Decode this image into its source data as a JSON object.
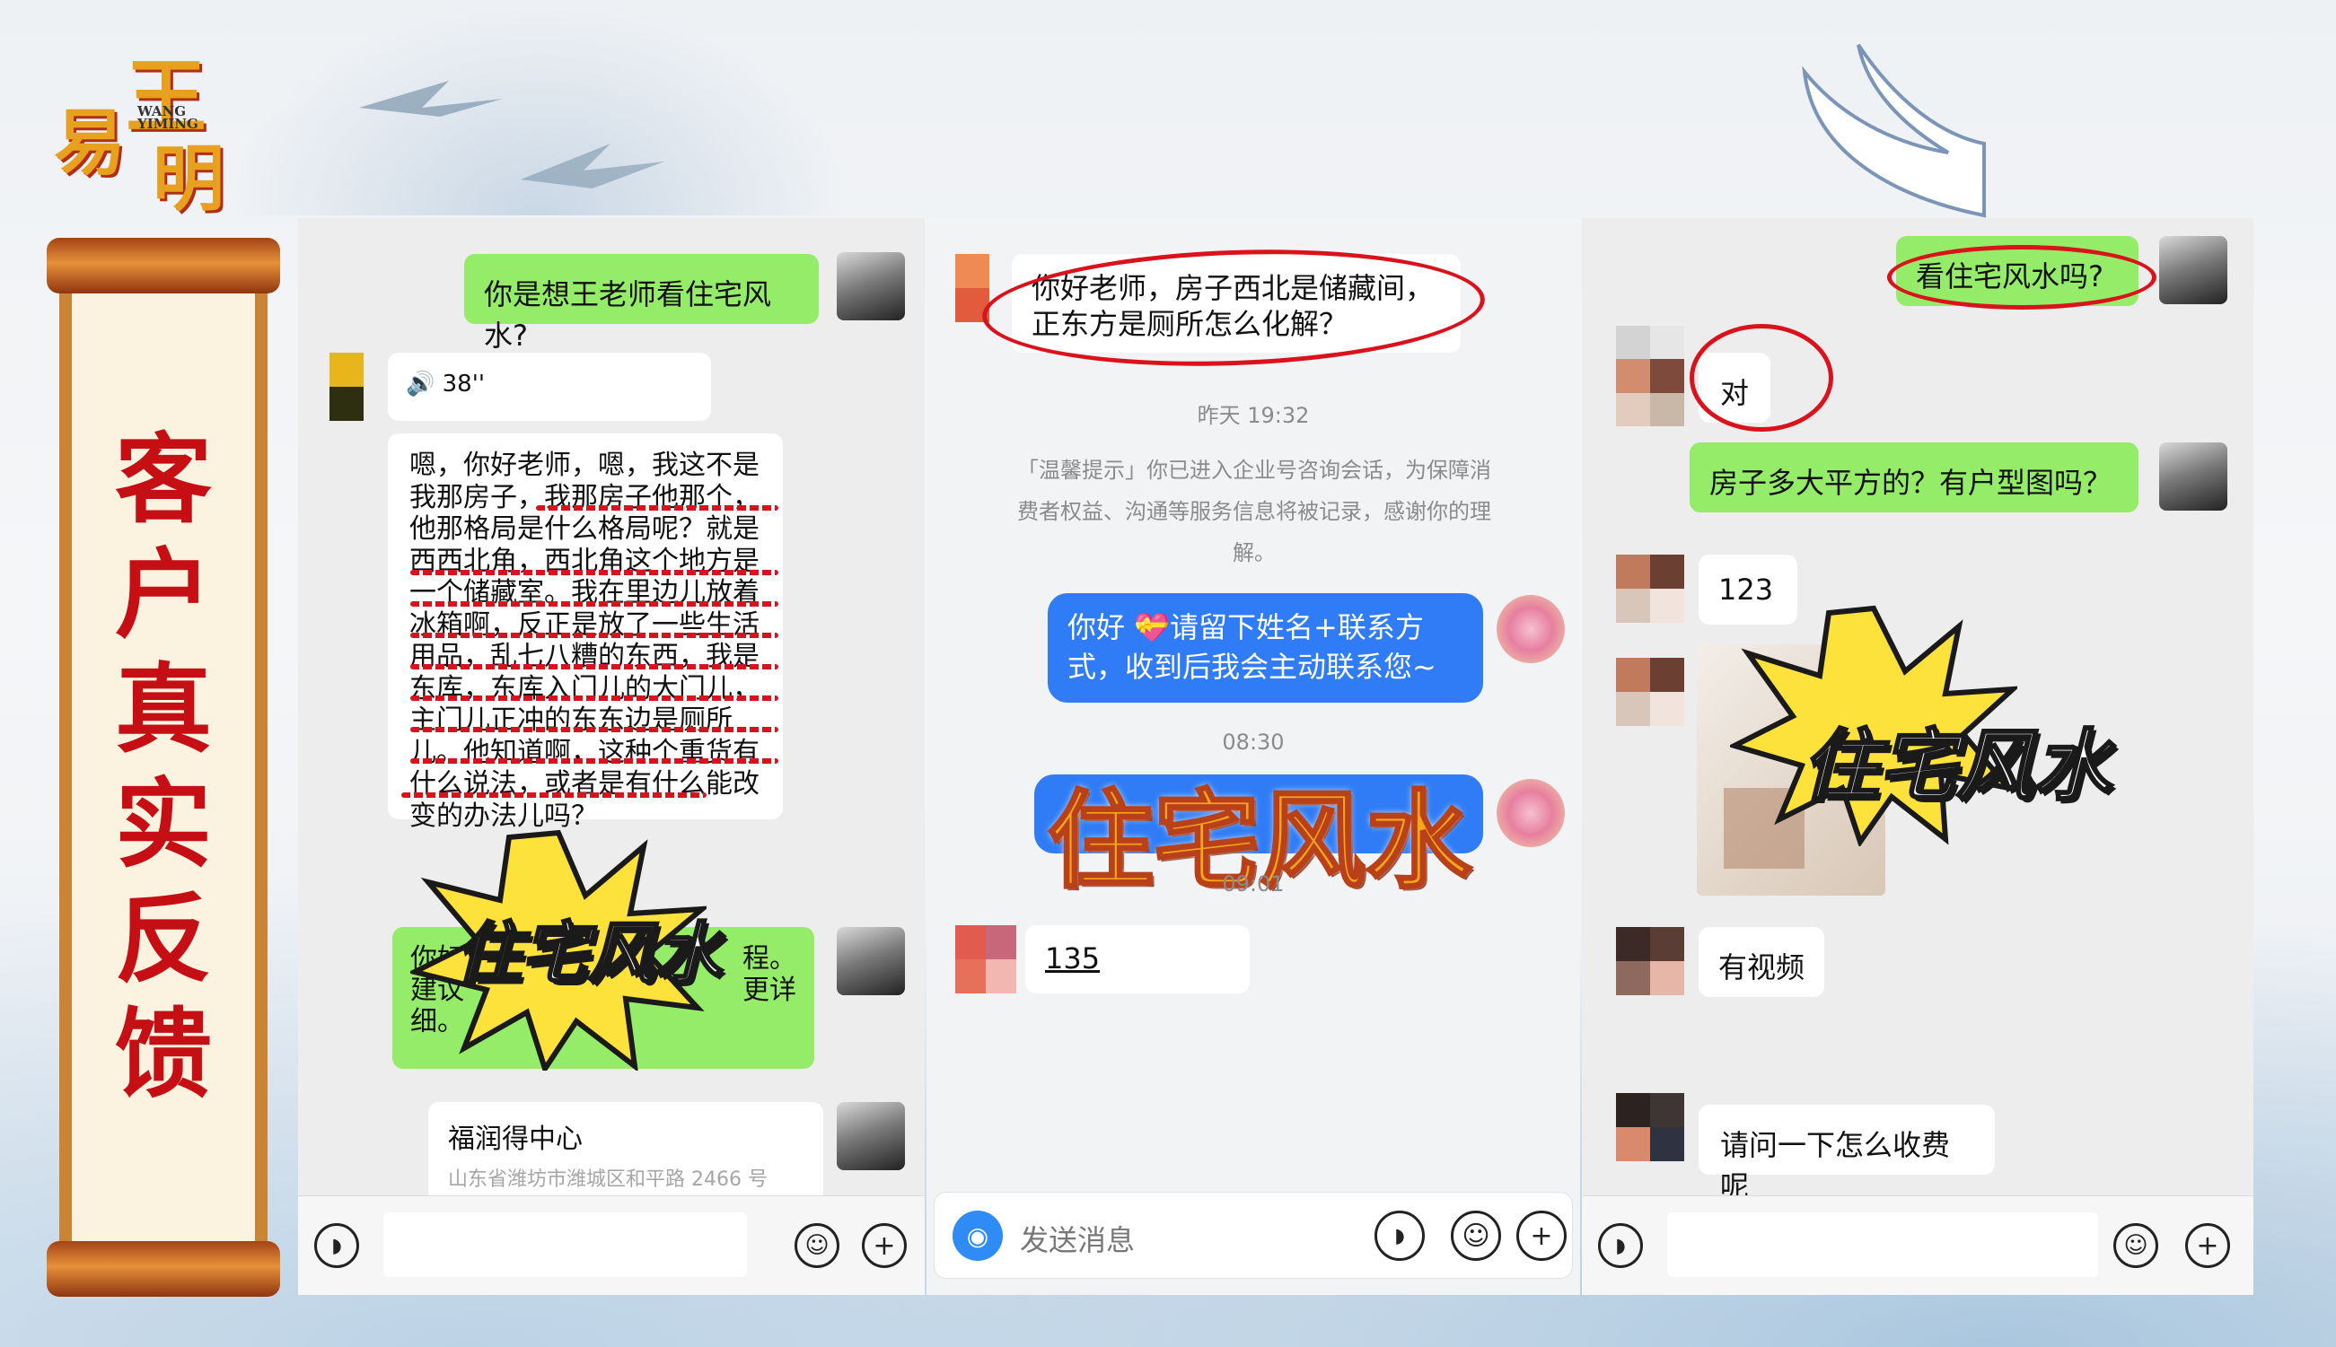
{
  "logo": {
    "char_top": "王",
    "char_left": "易",
    "char_bottom": "明",
    "latin_1": "WANG",
    "latin_2": "YIMING"
  },
  "scroll": {
    "title_chars": [
      "客",
      "户",
      "真",
      "实",
      "反",
      "馈"
    ]
  },
  "panel1": {
    "q1": "你是想王老师看住宅风水?",
    "voice_len": "38''",
    "transcript": "嗯，你好老师，嗯，我这不是我那房子，我那房子他那个，他那格局是什么格局呢？就是西西北角，西北角这个地方是一个储藏室。我在里边儿放着冰箱啊，反正是放了一些生活用品，乱七八糟的东西，我是东库，东库入门儿的大门儿，主门儿正冲的东东边是厕所儿。他知道啊，这种个重货有什么说法，或者是有什么能改变的办法儿吗？",
    "reply_start": "你好",
    "reply_mid_1": "建议",
    "reply_end_1": "程。",
    "reply_end_2": "更详",
    "reply_tail": "细。",
    "sticker": "住宅风水",
    "loc_title": "福润得中心",
    "loc_addr": "山东省潍坊市潍城区和平路 2466 号"
  },
  "panel2": {
    "q1": "你好老师，房子西北是储藏间，正东方是厕所怎么化解？",
    "ts1": "昨天 19:32",
    "notice": "「温馨提示」你已进入企业号咨询会话，为保障消费者权益、沟通等服务信息将被记录，感谢你的理解。",
    "bot_msg": "你好 💝请留下姓名+联系方式，收到后我会主动联系您~",
    "ts2": "08:30",
    "sticker": "住宅风水",
    "ts3": "09:01",
    "phone_partial": "135",
    "input_placeholder": "发送消息"
  },
  "panel3": {
    "q1": "看住宅风水吗?",
    "a1": "对",
    "q2": "房子多大平方的？有户型图吗？",
    "a2": "123",
    "sticker": "住宅风水",
    "a3": "有视频",
    "a4": "请问一下怎么收费呢"
  },
  "icons": {
    "voice": "voice-icon",
    "emoji": "emoji-icon",
    "plus": "plus-icon",
    "camera": "camera-icon"
  },
  "colors": {
    "green_bubble": "#95ec69",
    "blue_bubble": "#2f7cf6",
    "scroll_red": "#c50f15",
    "annotation_red": "#d9121b"
  }
}
